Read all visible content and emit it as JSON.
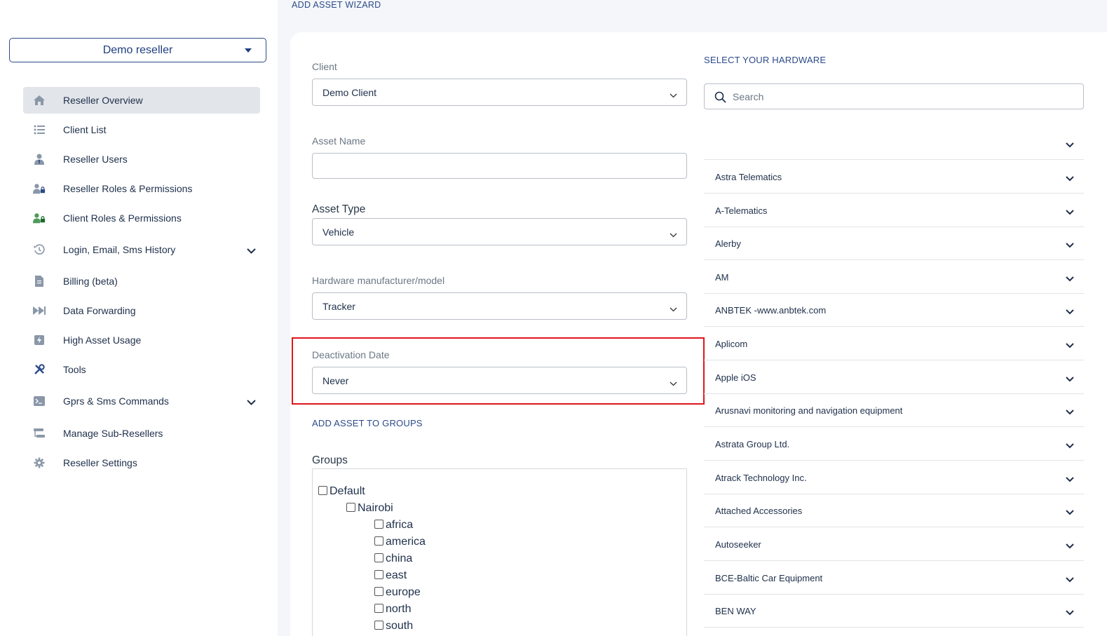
{
  "sidebar": {
    "reseller_selector": "Demo reseller",
    "items": [
      {
        "label": "Reseller Overview",
        "icon": "home-icon",
        "active": true
      },
      {
        "label": "Client List",
        "icon": "list-icon"
      },
      {
        "label": "Reseller Users",
        "icon": "user-tie-icon"
      },
      {
        "label": "Reseller Roles & Permissions",
        "icon": "user-lock-icon"
      },
      {
        "label": "Client Roles & Permissions",
        "icon": "user-lock-green-icon"
      },
      {
        "label": "Login, Email, Sms History",
        "icon": "history-icon",
        "expandable": true
      },
      {
        "label": "Billing (beta)",
        "icon": "invoice-icon"
      },
      {
        "label": "Data Forwarding",
        "icon": "forward-icon"
      },
      {
        "label": "High Asset Usage",
        "icon": "bolt-icon"
      },
      {
        "label": "Tools",
        "icon": "tools-icon"
      },
      {
        "label": "Gprs & Sms Commands",
        "icon": "terminal-icon",
        "expandable": true
      },
      {
        "label": "Manage Sub-Resellers",
        "icon": "sitemap-icon"
      },
      {
        "label": "Reseller Settings",
        "icon": "gear-icon"
      }
    ]
  },
  "wizard": {
    "title": "ADD ASSET WIZARD",
    "client_label": "Client",
    "client_value": "Demo Client",
    "asset_name_label": "Asset Name",
    "asset_name_value": "",
    "asset_type_label": "Asset Type",
    "asset_type_value": "Vehicle",
    "hardware_label": "Hardware manufacturer/model",
    "hardware_value": "Tracker",
    "deactivation_label": "Deactivation Date",
    "deactivation_value": "Never",
    "groups_heading": "ADD ASSET TO GROUPS",
    "groups_label": "Groups",
    "groups": [
      {
        "label": "Default",
        "level": 0
      },
      {
        "label": "Nairobi",
        "level": 1
      },
      {
        "label": "africa",
        "level": 2
      },
      {
        "label": "america",
        "level": 2
      },
      {
        "label": "china",
        "level": 2
      },
      {
        "label": "east",
        "level": 2
      },
      {
        "label": "europe",
        "level": 2
      },
      {
        "label": "north",
        "level": 2
      },
      {
        "label": "south",
        "level": 2
      }
    ]
  },
  "hardware": {
    "heading": "SELECT YOUR HARDWARE",
    "search_placeholder": "Search",
    "manufacturers": [
      "",
      "Astra Telematics",
      "A-Telematics",
      "Alerby",
      "AM",
      "ANBTEK -www.anbtek.com",
      "Aplicom",
      "Apple iOS",
      "Arusnavi monitoring and navigation equipment",
      "Astrata Group Ltd.",
      "Atrack Technology Inc.",
      "Attached Accessories",
      "Autoseeker",
      "BCE-Baltic Car Equipment",
      "BEN WAY"
    ]
  },
  "colors": {
    "accent": "#2c4a8a",
    "highlight": "#e0161c",
    "active_nav": "#e2e5ea"
  }
}
